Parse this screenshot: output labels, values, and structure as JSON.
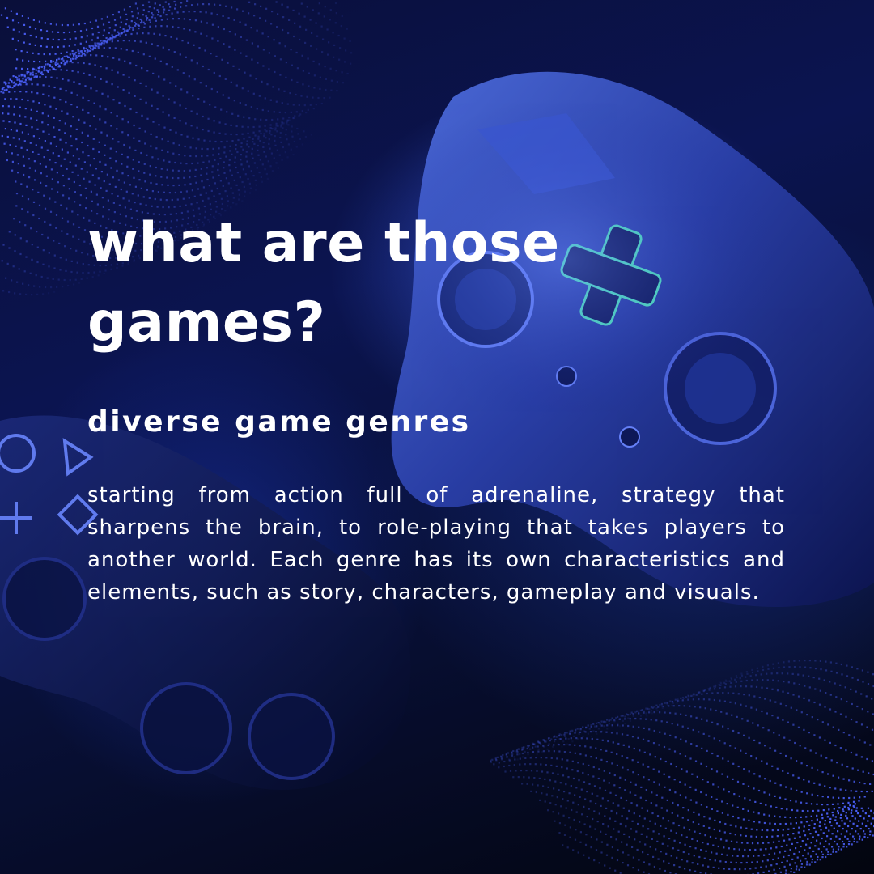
{
  "headline": "what are those games?",
  "subheading": "diverse game genres",
  "body": "starting from action full of adrenaline, strategy that sharpens the brain, to role-playing that takes players to another world. Each genre has its own characteristics and elements, such as story, characters, gameplay and visuals.",
  "colors": {
    "background_dark": "#05081c",
    "accent_blue": "#3f5cff",
    "text": "#ffffff"
  },
  "decor": {
    "top_left": "dotted-wave-pattern",
    "bottom_right": "dotted-wave-pattern",
    "main_controller": "game-controller-icon",
    "second_controller": "game-controller-icon"
  }
}
